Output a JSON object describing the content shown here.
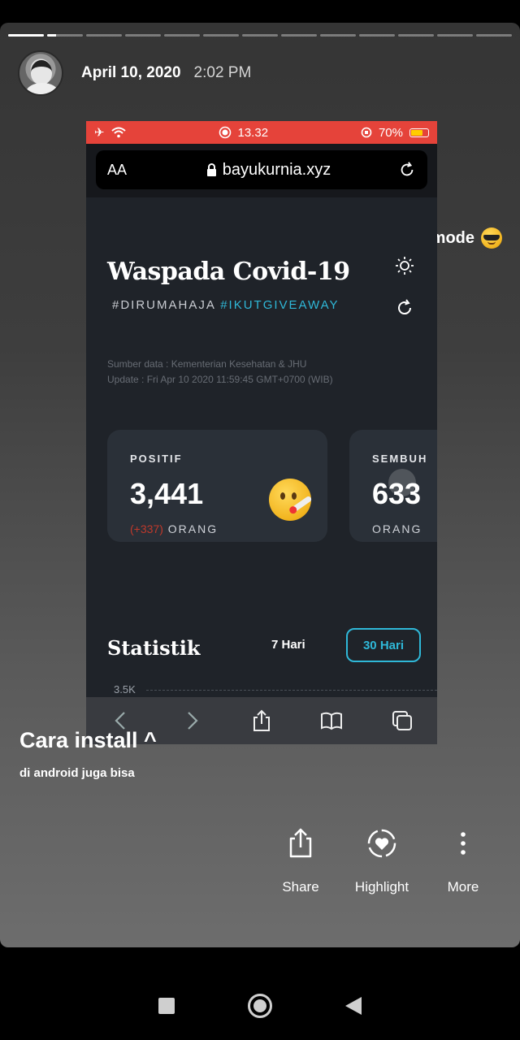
{
  "story": {
    "progress": {
      "segments": 13,
      "active_index": 1,
      "active_fraction": 0.25
    },
    "date": "April 10, 2020",
    "time": "2:02 PM",
    "overlay_dark": "Dark mode",
    "caption": "Cara install ^",
    "subcaption": "di android juga bisa",
    "actions": [
      {
        "label": "Share",
        "icon": "share-icon"
      },
      {
        "label": "Highlight",
        "icon": "highlight-heart-icon"
      },
      {
        "label": "More",
        "icon": "more-vertical-icon"
      }
    ]
  },
  "screenshot": {
    "statusbar": {
      "time": "13.32",
      "battery": "70%",
      "battery_level": 0.7,
      "bar_color": "#e5433a"
    },
    "address": {
      "aa": "AA",
      "url": "bayukurnia.xyz"
    },
    "page": {
      "title": "Waspada Covid-19",
      "hashtag1": "#DIRUMAHAJA",
      "hashtag2": "#IKUTGIVEAWAY",
      "source_line": "Sumber data : Kementerian Kesehatan & JHU",
      "update_line": "Update : Fri Apr 10 2020 11:59:45 GMT+0700 (WIB)",
      "cards": [
        {
          "label": "POSITIF",
          "value": "3,441",
          "delta": "(+337)",
          "unit": "ORANG"
        },
        {
          "label": "SEMBUH",
          "value": "633",
          "unit": "ORANG"
        }
      ],
      "stats_title": "Statistik",
      "range_7": "7 Hari",
      "range_30": "30 Hari",
      "y_tick": "3.5K"
    },
    "accent_color": "#2fb8d8"
  }
}
